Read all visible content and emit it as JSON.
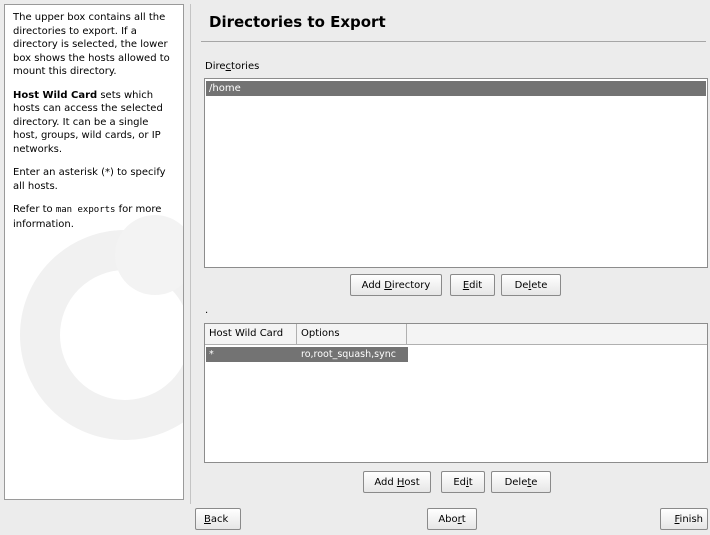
{
  "help": {
    "p1": "The upper box contains all the directories to export. If a directory is selected, the lower box shows the hosts allowed to mount this directory.",
    "p2_bold": "Host Wild Card",
    "p2_rest": " sets which hosts can access the selected directory. It can be a single host, groups, wild cards, or IP networks.",
    "p3": "Enter an asterisk (*) to specify all hosts.",
    "p4_pre": "Refer to ",
    "p4_code": "man exports",
    "p4_post": " for more information."
  },
  "main": {
    "title": "Directories to Export",
    "dirs_label": {
      "pre": "Dire",
      "mnemonic": "c",
      "post": "tories"
    },
    "directories": [
      "/home"
    ],
    "dir_buttons": {
      "add": {
        "pre": "Add ",
        "mnemonic": "D",
        "post": "irectory"
      },
      "edit": {
        "pre": "",
        "mnemonic": "E",
        "post": "dit"
      },
      "delete": {
        "pre": "De",
        "mnemonic": "l",
        "post": "ete"
      }
    },
    "separator_text": ".",
    "hosts_table": {
      "columns": [
        "Host Wild Card",
        "Options"
      ],
      "rows": [
        {
          "host": "*",
          "options": "ro,root_squash,sync"
        }
      ]
    },
    "host_buttons": {
      "add": {
        "pre": "Add ",
        "mnemonic": "H",
        "post": "ost"
      },
      "edit": {
        "pre": "Ed",
        "mnemonic": "i",
        "post": "t"
      },
      "delete": {
        "pre": "Dele",
        "mnemonic": "t",
        "post": "e"
      }
    }
  },
  "footer": {
    "back": {
      "pre": "",
      "mnemonic": "B",
      "post": "ack"
    },
    "abort": {
      "pre": "Abo",
      "mnemonic": "r",
      "post": "t"
    },
    "finish": {
      "pre": "",
      "mnemonic": "F",
      "post": "inish"
    }
  }
}
